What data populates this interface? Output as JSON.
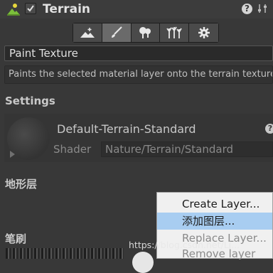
{
  "header": {
    "title": "Terrain",
    "help": "?",
    "enabled": true
  },
  "toolbar": {
    "tools": [
      {
        "icon": "raise-terrain-icon",
        "active": false
      },
      {
        "icon": "paint-brush-icon",
        "active": true
      },
      {
        "icon": "place-trees-icon",
        "active": false
      },
      {
        "icon": "paint-details-icon",
        "active": false
      },
      {
        "icon": "gear-icon",
        "active": false
      }
    ]
  },
  "tool_select": {
    "value": "Paint Texture"
  },
  "description": "Paints the selected material layer onto the terrain texture",
  "settings": {
    "heading": "Settings",
    "material_name": "Default-Terrain-Standard",
    "help": "?",
    "shader_label": "Shader",
    "shader_value": "Nature/Terrain/Standard"
  },
  "layers": {
    "heading": "地形层"
  },
  "brushes": {
    "heading": "笔刷"
  },
  "context_menu": {
    "items": [
      {
        "label": "Create Layer...",
        "state": "normal"
      },
      {
        "label": "添加图层...",
        "state": "highlighted"
      },
      {
        "label": "Replace Layer...",
        "state": "disabled"
      },
      {
        "label": "Remove layer",
        "state": "disabled"
      }
    ]
  },
  "watermark": "https://blog.csdn.net/Lj..."
}
